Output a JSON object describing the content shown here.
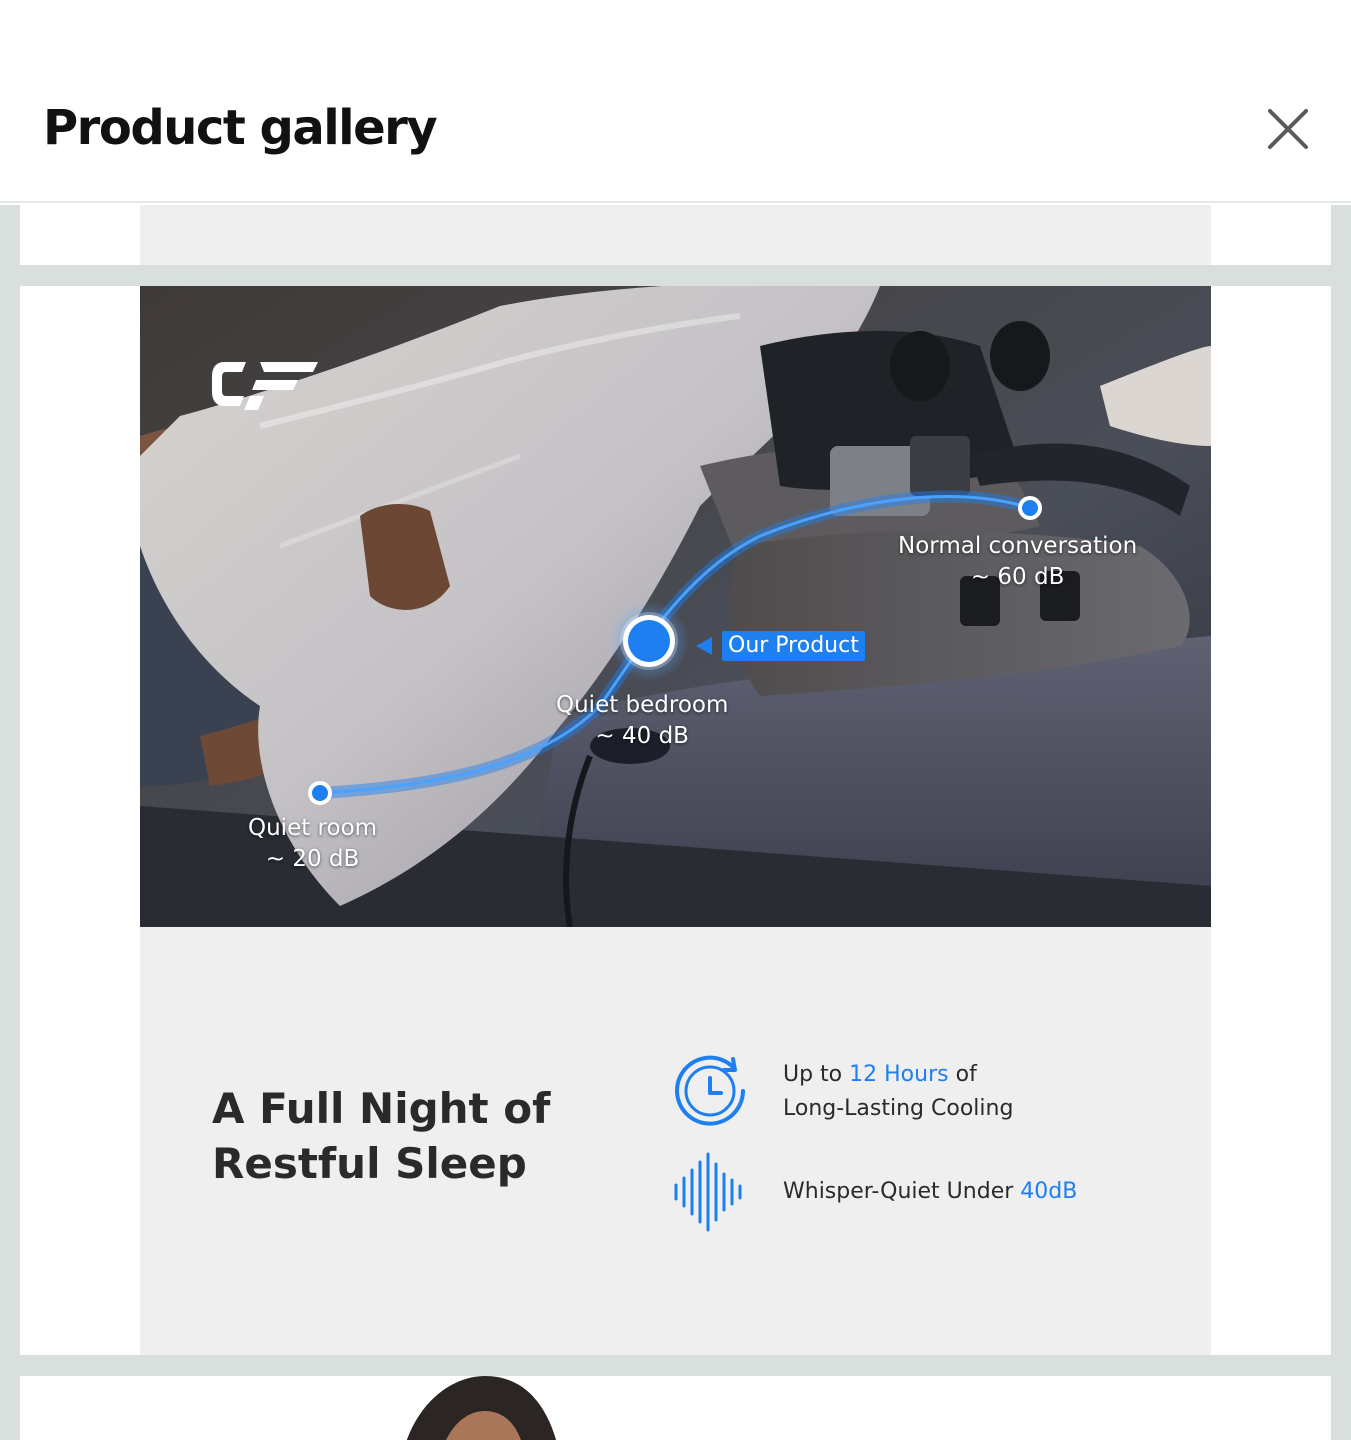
{
  "header": {
    "title": "Product gallery",
    "close_icon": "close-icon"
  },
  "product_image": {
    "logo_icon": "cf-brand-logo",
    "noise_points": {
      "normal_conversation": {
        "name": "Normal conversation",
        "level": "~ 60 dB"
      },
      "quiet_bedroom": {
        "name": "Quiet bedroom",
        "level": "~ 40 dB"
      },
      "quiet_room": {
        "name": "Quiet room",
        "level": "~ 20 dB"
      }
    },
    "our_product_tag": "Our Product",
    "headline_line1": "A Full Night of",
    "headline_line2": "Restful Sleep",
    "features": {
      "cooling": {
        "icon": "clock-icon",
        "line1_prefix": "Up to",
        "line1_accent": "12 Hours",
        "line1_suffix": "of",
        "line2": "Long-Lasting Cooling"
      },
      "quiet": {
        "icon": "sound-wave-icon",
        "prefix": "Whisper-Quiet Under",
        "accent": "40dB"
      }
    }
  },
  "colors": {
    "accent": "#1d7ff0",
    "gallery_background": "#d9dfdd",
    "card_background": "#efefef"
  }
}
